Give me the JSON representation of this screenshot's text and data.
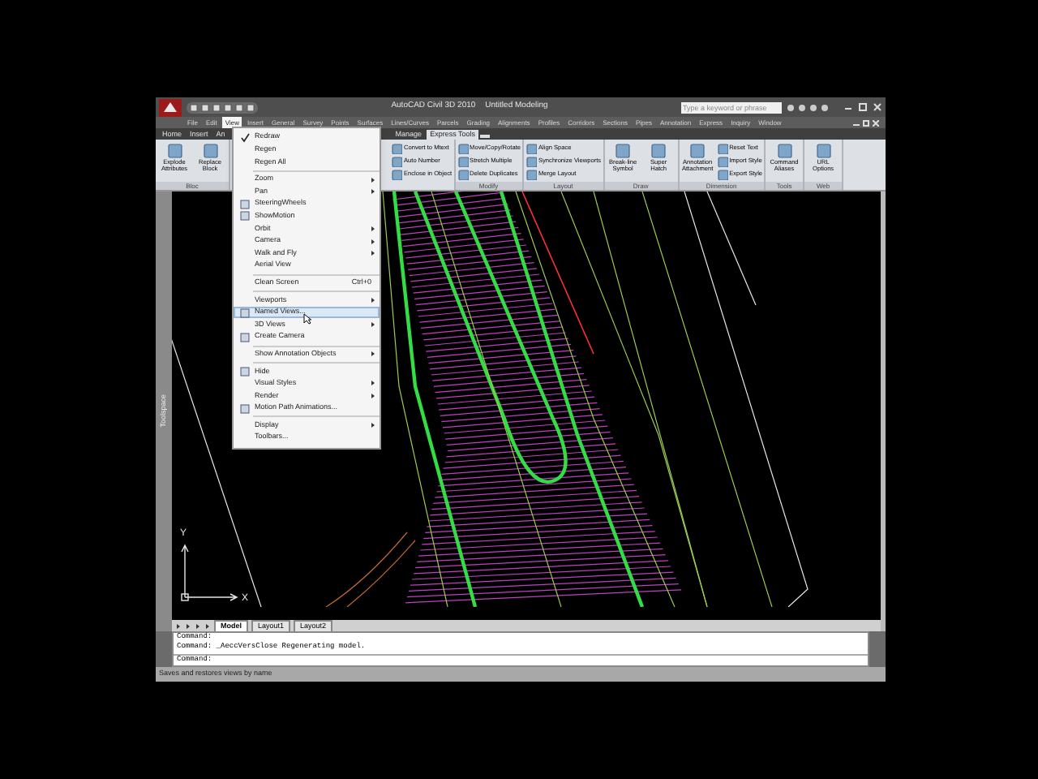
{
  "window": {
    "title": "AutoCAD Civil 3D 2010",
    "document": "Untitled Modeling",
    "search": {
      "placeholder": "Type a keyword or phrase"
    }
  },
  "menu_bar": [
    {
      "label": "File",
      "selected": false
    },
    {
      "label": "Edit",
      "selected": false
    },
    {
      "label": "View",
      "selected": true
    },
    {
      "label": "Insert",
      "selected": false
    },
    {
      "label": "General",
      "selected": false
    },
    {
      "label": "Survey",
      "selected": false
    },
    {
      "label": "Points",
      "selected": false
    },
    {
      "label": "Surfaces",
      "selected": false
    },
    {
      "label": "Lines/Curves",
      "selected": false
    },
    {
      "label": "Parcels",
      "selected": false
    },
    {
      "label": "Grading",
      "selected": false
    },
    {
      "label": "Alignments",
      "selected": false
    },
    {
      "label": "Profiles",
      "selected": false
    },
    {
      "label": "Corridors",
      "selected": false
    },
    {
      "label": "Sections",
      "selected": false
    },
    {
      "label": "Pipes",
      "selected": false
    },
    {
      "label": "Annotation",
      "selected": false
    },
    {
      "label": "Express",
      "selected": false
    },
    {
      "label": "Inquiry",
      "selected": false
    },
    {
      "label": "Window",
      "selected": false
    }
  ],
  "ribbon_tabs": [
    {
      "label": "Home",
      "selected": false
    },
    {
      "label": "Insert",
      "selected": false
    },
    {
      "label": "An",
      "selected": false
    },
    {
      "label": "Manage",
      "selected": false
    },
    {
      "label": "Express Tools",
      "selected": true
    }
  ],
  "ribbon_panels": [
    {
      "title": "Bloc",
      "tools": [
        {
          "kind": "large",
          "label": "Explode Attributes"
        },
        {
          "kind": "large",
          "label": "Replace Block"
        }
      ]
    },
    {
      "kind": "covered",
      "tools": [
        {
          "kind": "small",
          "label": "Convert to Mtext"
        },
        {
          "kind": "small",
          "label": "Auto Number"
        },
        {
          "kind": "small",
          "label": "Enclose in Object"
        }
      ]
    },
    {
      "title": "Modify",
      "tools": [
        {
          "kind": "small",
          "label": "Move/Copy/Rotate"
        },
        {
          "kind": "small",
          "label": "Stretch Multiple"
        },
        {
          "kind": "small",
          "label": "Delete Duplicates"
        }
      ]
    },
    {
      "title": "Layout",
      "tools": [
        {
          "kind": "small",
          "label": "Align Space"
        },
        {
          "kind": "small",
          "label": "Synchronize Viewports"
        },
        {
          "kind": "small",
          "label": "Merge Layout"
        }
      ]
    },
    {
      "title": "Draw",
      "tools": [
        {
          "kind": "large",
          "label": "Break-line Symbol"
        },
        {
          "kind": "large",
          "label": "Super Hatch"
        }
      ]
    },
    {
      "title": "Dimension",
      "tools": [
        {
          "kind": "large",
          "label": "Annotation Attachment"
        },
        {
          "kind": "small",
          "label": "Reset Text"
        },
        {
          "kind": "small",
          "label": "Import Style"
        },
        {
          "kind": "small",
          "label": "Export Style"
        }
      ]
    },
    {
      "title": "Tools",
      "tools": [
        {
          "kind": "large",
          "label": "Command Aliases"
        }
      ]
    },
    {
      "title": "Web",
      "tools": [
        {
          "kind": "large",
          "label": "URL Options"
        }
      ]
    }
  ],
  "view_menu": [
    {
      "kind": "checked",
      "label": "Redraw",
      "submenu": false,
      "selected": false
    },
    {
      "kind": "plain",
      "label": "Regen",
      "submenu": false,
      "selected": false
    },
    {
      "kind": "plain",
      "label": "Regen All",
      "submenu": false,
      "selected": false
    },
    {
      "kind": "separator"
    },
    {
      "kind": "plain",
      "label": "Zoom",
      "submenu": true,
      "selected": false
    },
    {
      "kind": "plain",
      "label": "Pan",
      "submenu": true,
      "selected": false
    },
    {
      "kind": "icon",
      "label": "SteeringWheels",
      "submenu": false,
      "selected": false
    },
    {
      "kind": "icon",
      "label": "ShowMotion",
      "submenu": false,
      "selected": false
    },
    {
      "kind": "plain",
      "label": "Orbit",
      "submenu": true,
      "selected": false
    },
    {
      "kind": "plain",
      "label": "Camera",
      "submenu": true,
      "selected": false
    },
    {
      "kind": "plain",
      "label": "Walk and Fly",
      "submenu": true,
      "selected": false
    },
    {
      "kind": "plain",
      "label": "Aerial View",
      "submenu": false,
      "selected": false
    },
    {
      "kind": "separator"
    },
    {
      "kind": "plain",
      "label": "Clean Screen",
      "shortcut": "Ctrl+0",
      "submenu": false,
      "selected": false
    },
    {
      "kind": "separator"
    },
    {
      "kind": "plain",
      "label": "Viewports",
      "submenu": true,
      "selected": false
    },
    {
      "kind": "icon",
      "label": "Named Views...",
      "submenu": false,
      "selected": true
    },
    {
      "kind": "plain",
      "label": "3D Views",
      "submenu": true,
      "selected": false
    },
    {
      "kind": "icon",
      "label": "Create Camera",
      "submenu": false,
      "selected": false
    },
    {
      "kind": "separator"
    },
    {
      "kind": "plain",
      "label": "Show Annotation Objects",
      "submenu": true,
      "selected": false
    },
    {
      "kind": "separator"
    },
    {
      "kind": "icon",
      "label": "Hide",
      "submenu": false,
      "selected": false
    },
    {
      "kind": "plain",
      "label": "Visual Styles",
      "submenu": true,
      "selected": false
    },
    {
      "kind": "plain",
      "label": "Render",
      "submenu": true,
      "selected": false
    },
    {
      "kind": "icon",
      "label": "Motion Path Animations...",
      "submenu": false,
      "selected": false
    },
    {
      "kind": "separator"
    },
    {
      "kind": "plain",
      "label": "Display",
      "submenu": true,
      "selected": false
    },
    {
      "kind": "plain",
      "label": "Toolbars...",
      "submenu": false,
      "selected": false
    }
  ],
  "toolspace_label": "Toolspace",
  "ucs": {
    "y_label": "Y",
    "x_label": "X"
  },
  "layout_tabs": [
    {
      "label": "Model",
      "selected": true
    },
    {
      "label": "Layout1",
      "selected": false
    },
    {
      "label": "Layout2",
      "selected": false
    }
  ],
  "command_history": [
    "Command:",
    "Command: _AeccVersClose Regenerating model."
  ],
  "command_prompt": "Command:",
  "status_bar": "Saves and restores views by name"
}
